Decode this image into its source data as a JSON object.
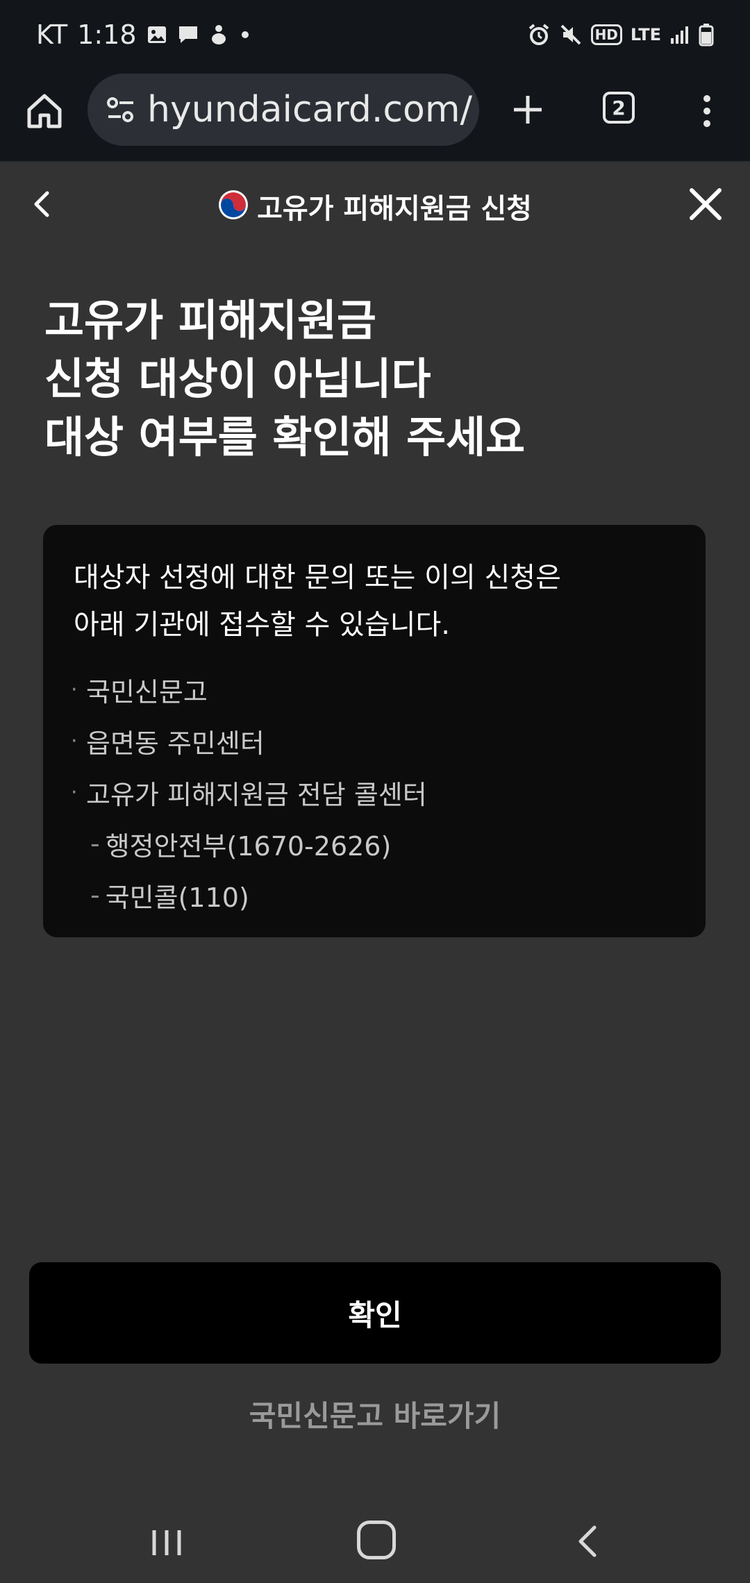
{
  "status_bar": {
    "carrier": "KT",
    "time": "1:18",
    "hd_label": "HD",
    "lte_label": "LTE",
    "left_icons": [
      "image-icon",
      "chat-icon",
      "app-notification-icon",
      "dot-icon"
    ],
    "right_icons": [
      "alarm-icon",
      "mute-icon",
      "hd-voice-icon",
      "lte-icon",
      "signal-icon",
      "battery-icon"
    ]
  },
  "browser": {
    "url": "hyundaicard.com/c",
    "tab_count": "2",
    "colors": {
      "toolbar_bg": "#121519",
      "urlbox_bg": "#2c3036"
    }
  },
  "header": {
    "title": "고유가 피해지원금 신청"
  },
  "headline": {
    "lines": [
      "고유가 피해지원금",
      "신청 대상이 아닙니다",
      "대상 여부를 확인해 주세요"
    ]
  },
  "info": {
    "intro_lines": [
      "대상자 선정에 대한 문의 또는 이의 신청은",
      "아래 기관에 접수할 수 있습니다."
    ],
    "items": [
      {
        "text": "국민신문고",
        "kind": "bullet"
      },
      {
        "text": "읍면동 주민센터",
        "kind": "bullet"
      },
      {
        "text": "고유가 피해지원금 전담 콜센터",
        "kind": "bullet"
      },
      {
        "text": "행정안전부(1670-2626)",
        "kind": "dash"
      },
      {
        "text": "국민콜(110)",
        "kind": "dash"
      }
    ]
  },
  "actions": {
    "confirm_label": "확인",
    "shortcut_label": "국민신문고 바로가기"
  },
  "colors": {
    "page_bg": "#333333",
    "card_bg": "#0c0c0c",
    "button_bg": "#000000",
    "muted_text": "#9a9a9a"
  }
}
